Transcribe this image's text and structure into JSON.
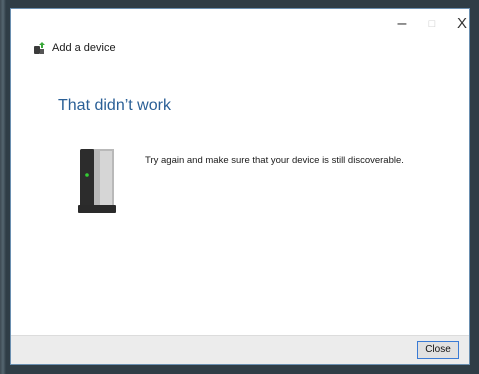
{
  "window": {
    "controls": {
      "minimize": "–",
      "maximize": "□",
      "close": "X"
    }
  },
  "header": {
    "title": "Add a device"
  },
  "main": {
    "title": "That didn’t work",
    "message": "Try again and make sure that your device is still discoverable."
  },
  "footer": {
    "close_label": "Close"
  },
  "colors": {
    "accent": "#2a5f96",
    "button_border": "#3a7bd5"
  },
  "icons": {
    "app": "add-device-icon",
    "device": "device-tower-icon"
  }
}
